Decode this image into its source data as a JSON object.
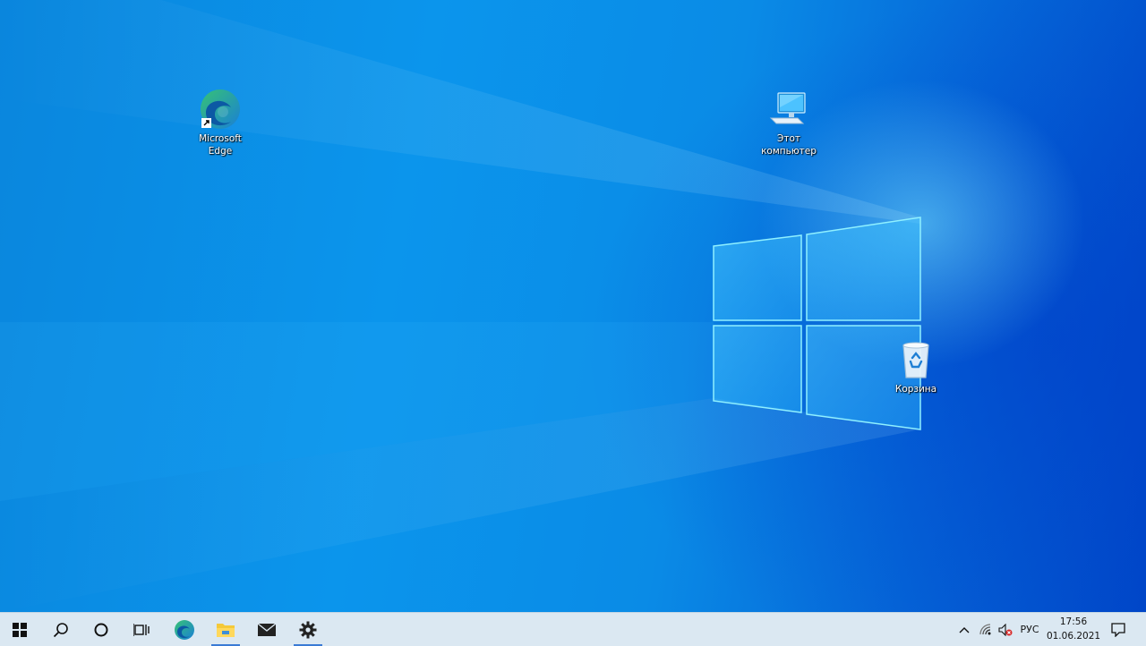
{
  "desktop": {
    "icons": [
      {
        "name": "microsoft-edge",
        "label": "Microsoft\nEdge"
      },
      {
        "name": "this-pc",
        "label": "Этот\nкомпьютер"
      },
      {
        "name": "recycle-bin",
        "label": "Корзина"
      }
    ]
  },
  "taskbar": {
    "buttons": [
      {
        "icon": "windows-logo-icon",
        "label": "Start"
      },
      {
        "icon": "search-icon",
        "label": "Search"
      },
      {
        "icon": "cortana-icon",
        "label": "Cortana"
      },
      {
        "icon": "task-view-icon",
        "label": "Task View"
      },
      {
        "icon": "edge-icon",
        "label": "Microsoft Edge"
      },
      {
        "icon": "file-explorer-icon",
        "label": "File Explorer"
      },
      {
        "icon": "mail-icon",
        "label": "Mail"
      },
      {
        "icon": "settings-icon",
        "label": "Settings"
      }
    ],
    "tray": {
      "chevron_icon": "chevron-up-icon",
      "network_icon": "wifi-icon",
      "volume_icon": "volume-muted-icon",
      "language": "РУС",
      "time": "17:56",
      "date": "01.06.2021",
      "notification_icon": "action-center-icon"
    }
  },
  "colors": {
    "taskbar_bg": "#dbe8f2",
    "active_indicator": "#3a7bd5"
  }
}
